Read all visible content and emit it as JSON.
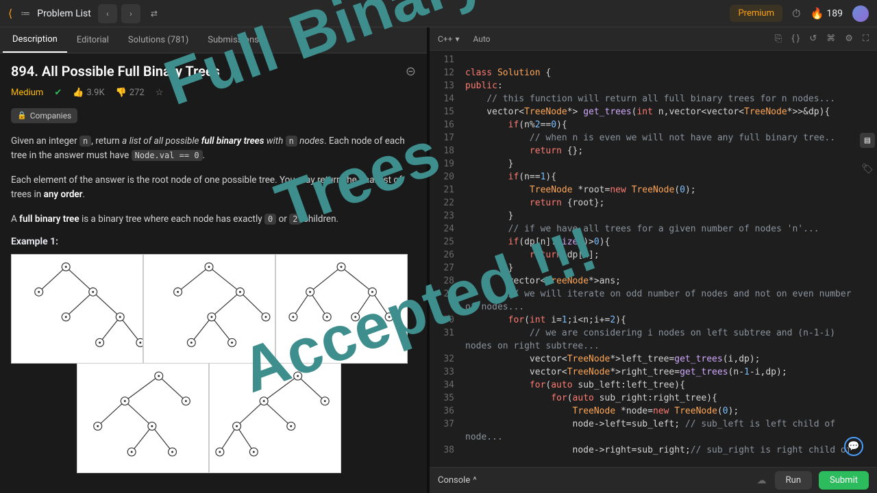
{
  "topbar": {
    "problem_list": "Problem List",
    "premium": "Premium",
    "streak": "189"
  },
  "left": {
    "tabs": {
      "description": "Description",
      "editorial": "Editorial",
      "solutions": "Solutions (781)",
      "submissions": "Submissions"
    },
    "title": "894. All Possible Full Binary Trees",
    "difficulty": "Medium",
    "likes": "3.9K",
    "dislikes": "272",
    "companies": "Companies",
    "p1a": "Given an integer ",
    "p1b": ", return ",
    "p1c": "a list of all possible ",
    "p1d": "full binary trees",
    "p1e": " with ",
    "p1f": " nodes",
    "p1g": ". Each node of each tree in the answer must have ",
    "p1h": "Node.val == 0",
    "p1i": ".",
    "p2a": "Each element of the answer is the root node of one possible tree. You may return the final list of trees in ",
    "p2b": "any order",
    "p2c": ".",
    "p3a": "A ",
    "p3b": "full binary tree",
    "p3c": " is a binary tree where each node has exactly ",
    "p3d": "0",
    "p3e": " or ",
    "p3f": "2",
    "p3g": " children.",
    "example_label": "Example 1:",
    "code_n": "n"
  },
  "right": {
    "language": "C++",
    "auto": "Auto",
    "console": "Console",
    "run": "Run",
    "submit": "Submit",
    "lines": [
      {
        "n": "11",
        "html": ""
      },
      {
        "n": "12",
        "html": "<span class='kw'>class</span> <span class='type'>Solution</span> {"
      },
      {
        "n": "13",
        "html": "<span class='kw'>public</span>:"
      },
      {
        "n": "14",
        "html": "    <span class='cm'>// this function will return all full binary trees for n nodes...</span>"
      },
      {
        "n": "15",
        "html": "    vector&lt;<span class='type'>TreeNode</span>*&gt; <span class='fn'>get_trees</span>(<span class='kw'>int</span> n,vector&lt;vector&lt;<span class='type'>TreeNode</span>*&gt;&gt;&amp;dp){"
      },
      {
        "n": "16",
        "html": "        <span class='kw'>if</span>(n%<span class='num'>2</span>==<span class='num'>0</span>){"
      },
      {
        "n": "17",
        "html": "            <span class='cm'>// when n is even we will not have any full binary tree..</span>"
      },
      {
        "n": "18",
        "html": "            <span class='kw'>return</span> {};"
      },
      {
        "n": "19",
        "html": "        }"
      },
      {
        "n": "20",
        "html": "        <span class='kw'>if</span>(n==<span class='num'>1</span>){"
      },
      {
        "n": "21",
        "html": "            <span class='type'>TreeNode</span> *root=<span class='kw'>new</span> <span class='type'>TreeNode</span>(<span class='num'>0</span>);"
      },
      {
        "n": "22",
        "html": "            <span class='kw'>return</span> {root};"
      },
      {
        "n": "23",
        "html": "        }"
      },
      {
        "n": "24",
        "html": "        <span class='cm'>// if we have all trees for a given number of nodes 'n'...</span>"
      },
      {
        "n": "25",
        "html": "        <span class='kw'>if</span>(dp[n].<span class='fn'>size</span>()&gt;<span class='num'>0</span>){"
      },
      {
        "n": "26",
        "html": "            <span class='kw'>return</span> dp[n];"
      },
      {
        "n": "27",
        "html": "        }"
      },
      {
        "n": "28",
        "html": "        vector&lt;<span class='type'>TreeNode</span>*&gt;ans;"
      },
      {
        "n": "29",
        "html": "        <span class='cm'>// we will iterate on odd number of nodes and not on even number</span>"
      },
      {
        "n": "29b",
        "html": "<span class='cm'>of nodes...</span>"
      },
      {
        "n": "30",
        "html": "        <span class='kw'>for</span>(<span class='kw'>int</span> i=<span class='num'>1</span>;i&lt;n;i+=<span class='num'>2</span>){"
      },
      {
        "n": "31",
        "html": "            <span class='cm'>// we are considering i nodes on left subtree and (n-1-i)</span>"
      },
      {
        "n": "31b",
        "html": "<span class='cm'>nodes on right subtree...</span>"
      },
      {
        "n": "32",
        "html": "            vector&lt;<span class='type'>TreeNode</span>*&gt;left_tree=<span class='fn'>get_trees</span>(i,dp);"
      },
      {
        "n": "33",
        "html": "            vector&lt;<span class='type'>TreeNode</span>*&gt;right_tree=<span class='fn'>get_trees</span>(n-<span class='num'>1</span>-i,dp);"
      },
      {
        "n": "34",
        "html": "            <span class='kw'>for</span>(<span class='kw'>auto</span> sub_left:left_tree){"
      },
      {
        "n": "35",
        "html": "                <span class='kw'>for</span>(<span class='kw'>auto</span> sub_right:right_tree){"
      },
      {
        "n": "36",
        "html": "                    <span class='type'>TreeNode</span> *node=<span class='kw'>new</span> <span class='type'>TreeNode</span>(<span class='num'>0</span>);"
      },
      {
        "n": "37",
        "html": "                    node-&gt;left=sub_left; <span class='cm'>// sub_left is left child of</span>"
      },
      {
        "n": "37b",
        "html": "<span class='cm'>node...</span>"
      },
      {
        "n": "38",
        "html": "                    node-&gt;right=sub_right;<span class='cm'>// sub_right is right child of</span>"
      }
    ]
  },
  "overlay": {
    "line1": "Full Binary",
    "line2": "Trees",
    "line3": "Accepted !!!"
  }
}
